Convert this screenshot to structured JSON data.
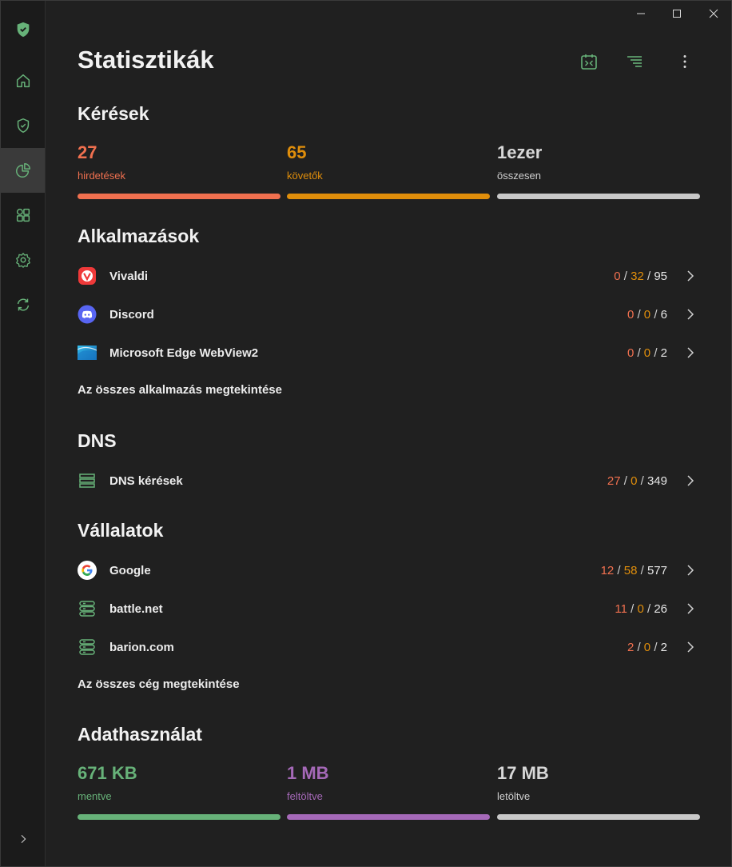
{
  "window": {
    "minimize": "minimize",
    "maximize": "maximize",
    "close": "close"
  },
  "page": {
    "title": "Statisztikák"
  },
  "requests": {
    "title": "Kérések",
    "ads": {
      "value": "27",
      "label": "hirdetések",
      "color": "#f0704f"
    },
    "trackers": {
      "value": "65",
      "label": "követők",
      "color": "#e08e0b"
    },
    "total": {
      "value": "1ezer",
      "label": "összesen",
      "color": "#c8c8c8"
    }
  },
  "apps": {
    "title": "Alkalmazások",
    "items": [
      {
        "name": "Vivaldi",
        "ads": "0",
        "trackers": "32",
        "total": "95",
        "icon": "vivaldi-icon"
      },
      {
        "name": "Discord",
        "ads": "0",
        "trackers": "0",
        "total": "6",
        "icon": "discord-icon"
      },
      {
        "name": "Microsoft Edge WebView2",
        "ads": "0",
        "trackers": "0",
        "total": "2",
        "icon": "edge-webview-icon"
      }
    ],
    "view_all": "Az összes alkalmazás megtekintése"
  },
  "dns": {
    "title": "DNS",
    "item": {
      "name": "DNS kérések",
      "ads": "27",
      "trackers": "0",
      "total": "349",
      "icon": "dns-server-icon"
    }
  },
  "companies": {
    "title": "Vállalatok",
    "items": [
      {
        "name": "Google",
        "ads": "12",
        "trackers": "58",
        "total": "577",
        "icon": "google-icon"
      },
      {
        "name": "battle.net",
        "ads": "11",
        "trackers": "0",
        "total": "26",
        "icon": "server-icon"
      },
      {
        "name": "barion.com",
        "ads": "2",
        "trackers": "0",
        "total": "2",
        "icon": "server-icon"
      }
    ],
    "view_all": "Az összes cég megtekintése"
  },
  "data_usage": {
    "title": "Adathasználat",
    "saved": {
      "value": "671 KB",
      "label": "mentve",
      "color": "#67b279"
    },
    "uploaded": {
      "value": "1 MB",
      "label": "feltöltve",
      "color": "#a569b8"
    },
    "downloaded": {
      "value": "17 MB",
      "label": "letöltve",
      "color": "#c8c8c8"
    }
  },
  "separator": "/"
}
